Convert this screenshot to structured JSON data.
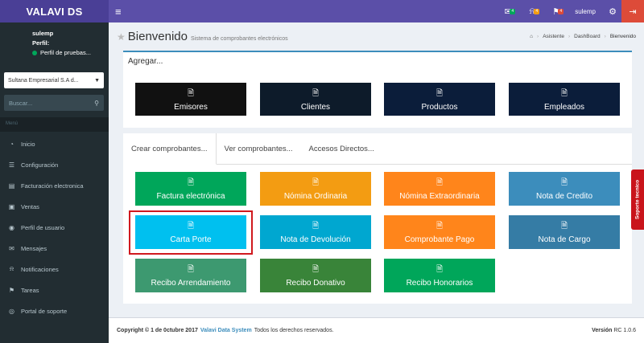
{
  "app": {
    "brand": "VALAVI DS"
  },
  "topbar": {
    "menu_icon": "≡",
    "notifications": [
      {
        "icon": "envelope-icon",
        "glyph": "✉",
        "badge": "4",
        "badge_color": "#00a65a"
      },
      {
        "icon": "bell-icon",
        "glyph": "⍾",
        "badge": "4",
        "badge_color": "#f39c12"
      },
      {
        "icon": "flag-icon",
        "glyph": "⚑",
        "badge": "4",
        "badge_color": "#dd4b39"
      }
    ],
    "username": "sulemp",
    "gear_glyph": "⚙",
    "exit_glyph": "⇥"
  },
  "sidebar": {
    "user_name": "sulemp",
    "profile_label": "Perfil:",
    "profile_status": "Perfil de pruebas...",
    "company": "Sultana Empresarial S.A d...",
    "search_placeholder": "Buscar...",
    "menu_header": "Menú",
    "items": [
      {
        "label": "Inicio",
        "icon": "dashboard-icon",
        "glyph": "◔"
      },
      {
        "label": "Configuración",
        "icon": "sliders-icon",
        "glyph": "☰"
      },
      {
        "label": "Facturación electronica",
        "icon": "invoice-icon",
        "glyph": "▤"
      },
      {
        "label": "Ventas",
        "icon": "truck-icon",
        "glyph": "▣"
      },
      {
        "label": "Perfil de usuario",
        "icon": "user-icon",
        "glyph": "◉"
      },
      {
        "label": "Mensajes",
        "icon": "envelope-icon",
        "glyph": "✉"
      },
      {
        "label": "Notificaciones",
        "icon": "bell-icon",
        "glyph": "⍾"
      },
      {
        "label": "Tareas",
        "icon": "flag-icon",
        "glyph": "⚑"
      },
      {
        "label": "Portal de soporte",
        "icon": "support-icon",
        "glyph": "◎"
      }
    ]
  },
  "header": {
    "title": "Bienvenido",
    "subtitle": "Sistema de comprobantes electrónicos",
    "breadcrumb": [
      "Asistente",
      "DashBoard",
      "Bienvenido"
    ]
  },
  "agregar": {
    "title": "Agregar...",
    "buttons": [
      {
        "label": "Emisores",
        "color": "#111111"
      },
      {
        "label": "Clientes",
        "color": "#0d1b2a"
      },
      {
        "label": "Productos",
        "color": "#0b1d3a"
      },
      {
        "label": "Empleados",
        "color": "#0b1d3a"
      }
    ]
  },
  "tabs": [
    "Crear comprobantes...",
    "Ver comprobantes...",
    "Accesos Directos..."
  ],
  "tiles": [
    {
      "label": "Factura electrónica",
      "color": "#00a65a"
    },
    {
      "label": "Nómina Ordinaria",
      "color": "#f39c12"
    },
    {
      "label": "Nómina Extraordinaria",
      "color": "#ff851b"
    },
    {
      "label": "Nota de Credito",
      "color": "#3c8dbc"
    },
    {
      "label": "Carta Porte",
      "color": "#00c0ef"
    },
    {
      "label": "Nota de Devolución",
      "color": "#00a7d0"
    },
    {
      "label": "Comprobante Pago",
      "color": "#ff851b"
    },
    {
      "label": "Nota de Cargo",
      "color": "#357ca5"
    },
    {
      "label": "Recibo Arrendamiento",
      "color": "#3d9970"
    },
    {
      "label": "Recibo Donativo",
      "color": "#398439"
    },
    {
      "label": "Recibo Honorarios",
      "color": "#00a65a"
    }
  ],
  "support_tab": "Soporte tecnico",
  "footer": {
    "copyright": "Copyright © 1 de 0ctubre 2017",
    "brand": "Valavi Data System",
    "rights": "Todos los derechos reservados.",
    "version_label": "Versión",
    "version": "RC 1.0.6"
  }
}
